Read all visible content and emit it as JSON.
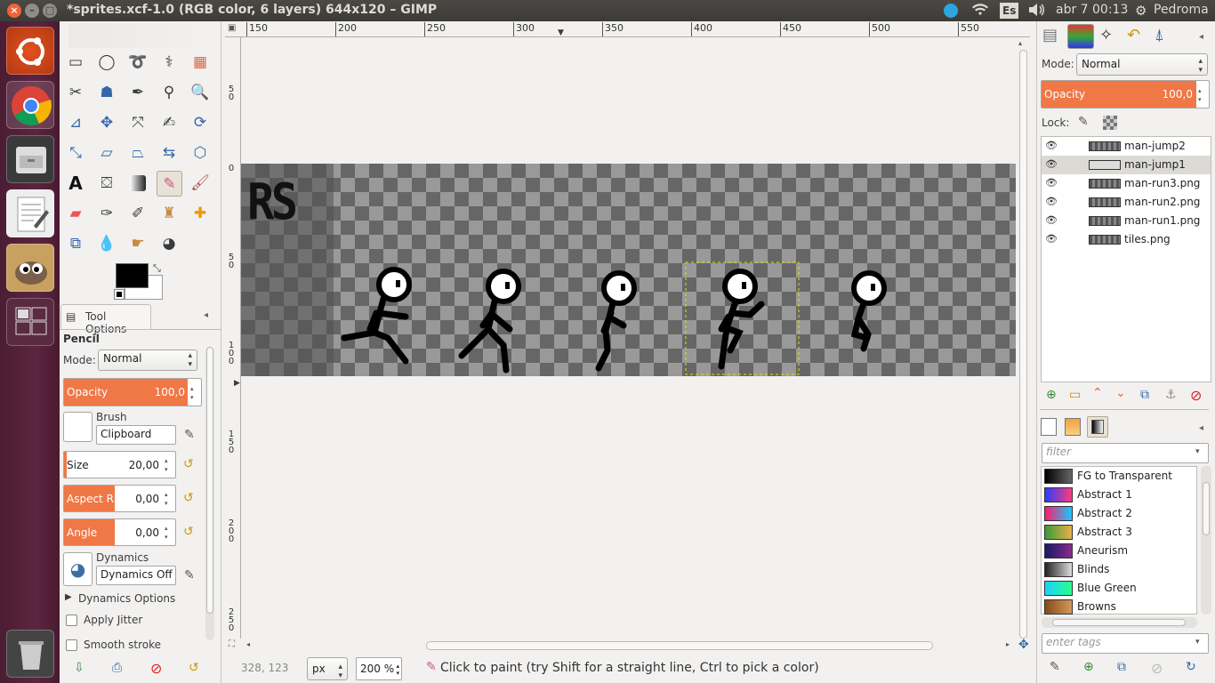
{
  "window": {
    "title": "*sprites.xcf-1.0 (RGB color, 6 layers) 644x120 – GIMP",
    "close": "×",
    "min": "–",
    "max": "□"
  },
  "tray": {
    "lang": "Es",
    "datetime": "abr 7 00:13",
    "user": "Pedroma"
  },
  "launcher": [
    "ubuntu-dash",
    "chrome",
    "files",
    "text-editor",
    "gimp",
    "workspace-switcher",
    "trash"
  ],
  "toolbox": {
    "tool_options_tab": "Tool Options",
    "tool_name": "Pencil",
    "mode_label": "Mode:",
    "mode_value": "Normal",
    "opacity_label": "Opacity",
    "opacity_value": "100,0",
    "brush_label": "Brush",
    "brush_value": "Clipboard",
    "size_label": "Size",
    "size_value": "20,00",
    "aspect_label": "Aspect R...",
    "aspect_value": "0,00",
    "angle_label": "Angle",
    "angle_value": "0,00",
    "dynamics_label": "Dynamics",
    "dynamics_value": "Dynamics Off",
    "dynamics_options": "Dynamics Options",
    "apply_jitter": "Apply Jitter",
    "smooth_stroke": "Smooth stroke"
  },
  "ruler": {
    "top": [
      "150",
      "200",
      "250",
      "300",
      "350",
      "400",
      "450",
      "500",
      "550"
    ],
    "left": [
      "5\n0",
      "0",
      "5\n0",
      "1\n0\n0",
      "1\n5\n0",
      "2\n0\n0",
      "2\n5\n0"
    ]
  },
  "canvas": {
    "sprite_text": "RS"
  },
  "status": {
    "coords": "328, 123",
    "unit": "px",
    "zoom": "200 %",
    "message": "Click to paint (try Shift for a straight line, Ctrl to pick a color)"
  },
  "layers": {
    "mode_label": "Mode:",
    "mode_value": "Normal",
    "opacity_label": "Opacity",
    "opacity_value": "100,0",
    "lock_label": "Lock:",
    "items": [
      {
        "name": "man-jump2",
        "selected": false
      },
      {
        "name": "man-jump1",
        "selected": true
      },
      {
        "name": "man-run3.png",
        "selected": false
      },
      {
        "name": "man-run2.png",
        "selected": false
      },
      {
        "name": "man-run1.png",
        "selected": false
      },
      {
        "name": "tiles.png",
        "selected": false
      }
    ]
  },
  "gradients": {
    "filter_placeholder": "filter",
    "tags_placeholder": "enter tags",
    "items": [
      {
        "name": "FG to Transparent",
        "colors": [
          "#000000",
          "#666666"
        ]
      },
      {
        "name": "Abstract 1",
        "colors": [
          "#2a3cff",
          "#ff3c7a"
        ]
      },
      {
        "name": "Abstract 2",
        "colors": [
          "#ff1a6a",
          "#1ac8ff"
        ]
      },
      {
        "name": "Abstract 3",
        "colors": [
          "#3a9a3a",
          "#e8b04a"
        ]
      },
      {
        "name": "Aneurism",
        "colors": [
          "#1a1a6a",
          "#8a2a8a"
        ]
      },
      {
        "name": "Blinds",
        "colors": [
          "#222222",
          "#dddddd"
        ]
      },
      {
        "name": "Blue Green",
        "colors": [
          "#1ad0ff",
          "#2aff8a"
        ]
      },
      {
        "name": "Browns",
        "colors": [
          "#8a4a1a",
          "#d09a5a"
        ]
      }
    ]
  }
}
